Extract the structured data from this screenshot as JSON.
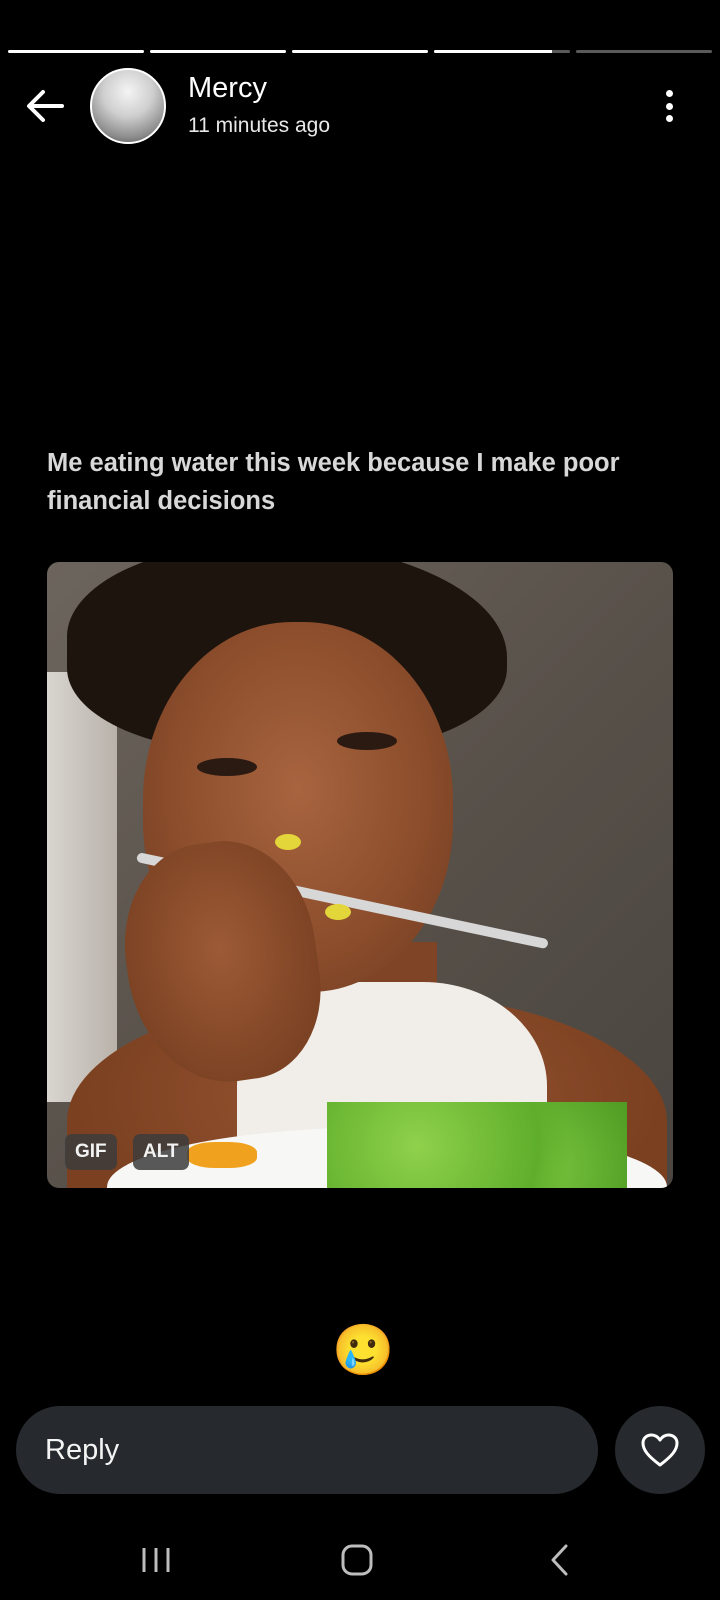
{
  "story": {
    "segments": [
      {
        "fill": 1.0
      },
      {
        "fill": 1.0
      },
      {
        "fill": 1.0
      },
      {
        "fill": 0.87
      },
      {
        "fill": 0.0
      }
    ]
  },
  "header": {
    "username": "Mercy",
    "time_ago": "11 minutes ago",
    "back_icon": "arrow-left-icon",
    "menu_icon": "more-vertical-icon"
  },
  "post": {
    "caption": "Me eating water this week because I make poor financial decisions",
    "badges": {
      "gif": "GIF",
      "alt": "ALT"
    }
  },
  "reaction": {
    "emoji": "🥲"
  },
  "footer": {
    "reply_label": "Reply",
    "like_icon": "heart-icon"
  },
  "navbar": {
    "recents_icon": "recents-icon",
    "home_icon": "home-icon",
    "back_icon": "back-chevron-icon"
  }
}
